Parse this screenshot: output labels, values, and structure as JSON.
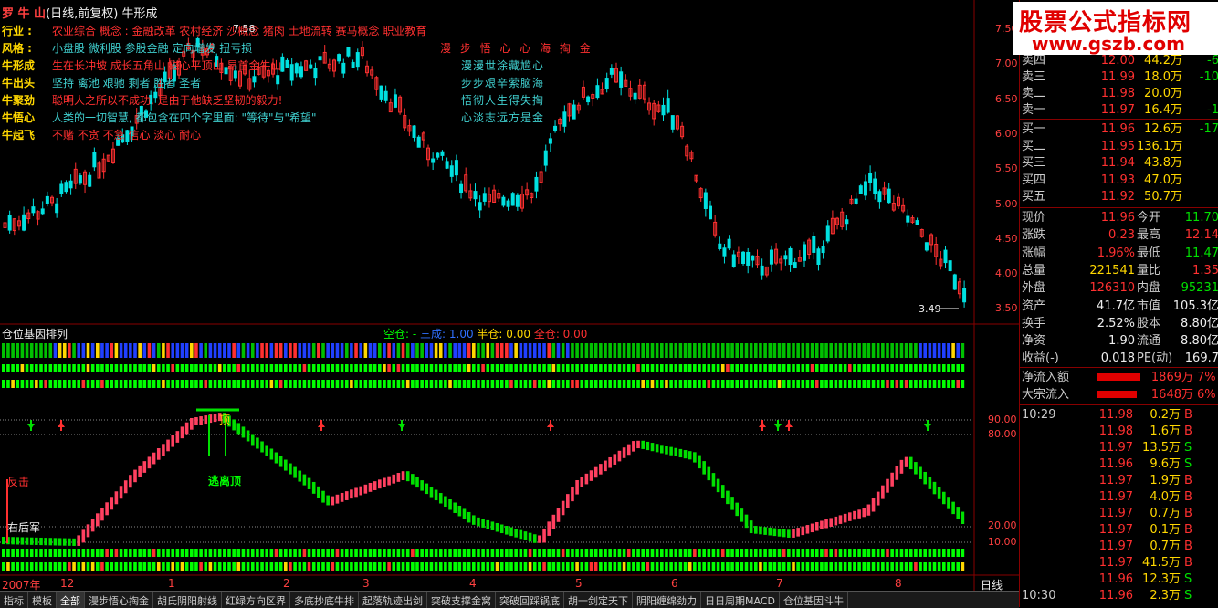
{
  "header": {
    "name": "罗 牛 山",
    "rest": "(日线,前复权) 牛形成"
  },
  "info_rows": [
    {
      "label": "行业 :",
      "segments": [
        {
          "t": "农业综合   概念 : 金融改革 农村经济 沙概念 猪肉 土地流转 赛马概念 职业教育",
          "c": "red"
        }
      ],
      "right": ""
    },
    {
      "label": "风格 :",
      "segments": [
        {
          "t": "小盘股 微利股 参股金融 定向增发 扭亏损",
          "c": "cyan"
        }
      ],
      "right": "漫 步 悟 心 心 海 掏 金",
      "right_c": "red"
    },
    {
      "label": "牛形成",
      "segments": [
        {
          "t": "生在长冲坡 成长五角山 磁心平顶山 昂首金牛山",
          "c": "red"
        }
      ],
      "right": "漫漫世涂藏尴心",
      "right_c": "cyan"
    },
    {
      "label": "牛出头",
      "segments": [
        {
          "t": "坚持  禽池  艰驰  剩者  胜者  圣者",
          "c": "cyan"
        }
      ],
      "right": "步步艰辛萦脑海",
      "right_c": "cyan"
    },
    {
      "label": "牛聚劲",
      "segments": [
        {
          "t": "聪明人之所以不成功, 是由于他缺乏坚韧的毅力!",
          "c": "red"
        }
      ],
      "right": "悟彻人生得失掏",
      "right_c": "cyan"
    },
    {
      "label": "牛悟心",
      "segments": [
        {
          "t": "人类的一切智慧, 都包含在四个字里面: \"等待\"与\"希望\"",
          "c": "cyan"
        }
      ],
      "right": "心淡志远方是金",
      "right_c": "cyan"
    },
    {
      "label": "牛起飞",
      "segments": [
        {
          "t": "不赌  不贪  不急  信心  淡心  耐心",
          "c": "red"
        }
      ],
      "right": ""
    }
  ],
  "price_labels": {
    "high": "7.58",
    "low": "3.49"
  },
  "price_axis": [
    "7.50",
    "7.00",
    "6.50",
    "6.00",
    "5.50",
    "5.00",
    "4.50",
    "4.00",
    "3.50"
  ],
  "sub_panel": {
    "title": "仓位基因排列",
    "legend": [
      {
        "t": "空仓: -",
        "c": "g"
      },
      {
        "t": "三成: 1.00",
        "c": "b"
      },
      {
        "t": "半仓: 0.00",
        "c": "y"
      },
      {
        "t": "全仓: 0.00",
        "c": "r"
      }
    ]
  },
  "lower_axis": [
    "90.00",
    "80.00",
    "20.00",
    "10.00"
  ],
  "annotations": {
    "top": "顶",
    "escape": "逃离顶",
    "counter": "反击",
    "rear": "右后军"
  },
  "date_axis": [
    "2007年",
    "12",
    "1",
    "2",
    "3",
    "4",
    "5",
    "6",
    "7",
    "8"
  ],
  "period": "日线",
  "tabs": [
    "指标",
    "模板",
    "全部",
    "漫步悟心掏金",
    "胡氏阴阳射线",
    "红绿方向区界",
    "多底抄底牛排",
    "起落轨迹出剑",
    "突破支撑金窝",
    "突破回踩锅底",
    "胡一剑定天下",
    "阴阳缠绵劲力",
    "日日周期MACD",
    "仓位基因斗牛"
  ],
  "watermark": {
    "line1": "股票公式指标网",
    "line2": "www.gszb.com"
  },
  "asks": [
    {
      "label": "卖四",
      "price": "12.00",
      "vol": "44.2万",
      "chg": "-6"
    },
    {
      "label": "卖三",
      "price": "11.99",
      "vol": "18.0万",
      "chg": "-10"
    },
    {
      "label": "卖二",
      "price": "11.98",
      "vol": "20.0万",
      "chg": ""
    },
    {
      "label": "卖一",
      "price": "11.97",
      "vol": "16.4万",
      "chg": "-1"
    }
  ],
  "bids": [
    {
      "label": "买一",
      "price": "11.96",
      "vol": "12.6万",
      "chg": "-17"
    },
    {
      "label": "买二",
      "price": "11.95",
      "vol": "136.1万",
      "chg": ""
    },
    {
      "label": "买三",
      "price": "11.94",
      "vol": "43.8万",
      "chg": ""
    },
    {
      "label": "买四",
      "price": "11.93",
      "vol": "47.0万",
      "chg": ""
    },
    {
      "label": "买五",
      "price": "11.92",
      "vol": "50.7万",
      "chg": ""
    }
  ],
  "fund": [
    {
      "k1": "现价",
      "v1": "11.96",
      "c1": "#ff3030",
      "k2": "今开",
      "v2": "11.70",
      "c2": "#00e000"
    },
    {
      "k1": "涨跌",
      "v1": "0.23",
      "c1": "#ff3030",
      "k2": "最高",
      "v2": "12.14",
      "c2": "#ff3030"
    },
    {
      "k1": "涨幅",
      "v1": "1.96%",
      "c1": "#ff3030",
      "k2": "最低",
      "v2": "11.47",
      "c2": "#00e000"
    },
    {
      "k1": "总量",
      "v1": "221541",
      "c1": "#ffd700",
      "k2": "量比",
      "v2": "1.35",
      "c2": "#ff3030"
    },
    {
      "k1": "外盘",
      "v1": "126310",
      "c1": "#ff3030",
      "k2": "内盘",
      "v2": "95231",
      "c2": "#00e000"
    },
    {
      "k1": "资产",
      "v1": "41.7亿",
      "c1": "#eee",
      "k2": "市值",
      "v2": "105.3亿",
      "c2": "#eee"
    },
    {
      "k1": "换手",
      "v1": "2.52%",
      "c1": "#eee",
      "k2": "股本",
      "v2": "8.80亿",
      "c2": "#eee"
    },
    {
      "k1": "净资",
      "v1": "1.90",
      "c1": "#eee",
      "k2": "流通",
      "v2": "8.80亿",
      "c2": "#eee"
    },
    {
      "k1": "收益(-)",
      "v1": "0.018",
      "c1": "#eee",
      "k2": "PE(动)",
      "v2": "169.7",
      "c2": "#eee"
    }
  ],
  "flows": [
    {
      "k": "净流入额",
      "v": "1869万",
      "p": "7%"
    },
    {
      "k": "大宗流入",
      "v": "1648万",
      "p": "6%"
    }
  ],
  "ticks": [
    {
      "tm": "10:29",
      "pr": "11.98",
      "vo": "0.2万",
      "bs": "B"
    },
    {
      "tm": "",
      "pr": "11.98",
      "vo": "1.6万",
      "bs": "B"
    },
    {
      "tm": "",
      "pr": "11.97",
      "vo": "13.5万",
      "bs": "S"
    },
    {
      "tm": "",
      "pr": "11.96",
      "vo": "9.6万",
      "bs": "S"
    },
    {
      "tm": "",
      "pr": "11.97",
      "vo": "1.9万",
      "bs": "B"
    },
    {
      "tm": "",
      "pr": "11.97",
      "vo": "4.0万",
      "bs": "B"
    },
    {
      "tm": "",
      "pr": "11.97",
      "vo": "0.7万",
      "bs": "B"
    },
    {
      "tm": "",
      "pr": "11.97",
      "vo": "0.1万",
      "bs": "B"
    },
    {
      "tm": "",
      "pr": "11.97",
      "vo": "0.7万",
      "bs": "B"
    },
    {
      "tm": "",
      "pr": "11.97",
      "vo": "41.5万",
      "bs": "B"
    },
    {
      "tm": "",
      "pr": "11.96",
      "vo": "12.3万",
      "bs": "S"
    },
    {
      "tm": "10:30",
      "pr": "11.96",
      "vo": "2.3万",
      "bs": "S"
    }
  ]
}
